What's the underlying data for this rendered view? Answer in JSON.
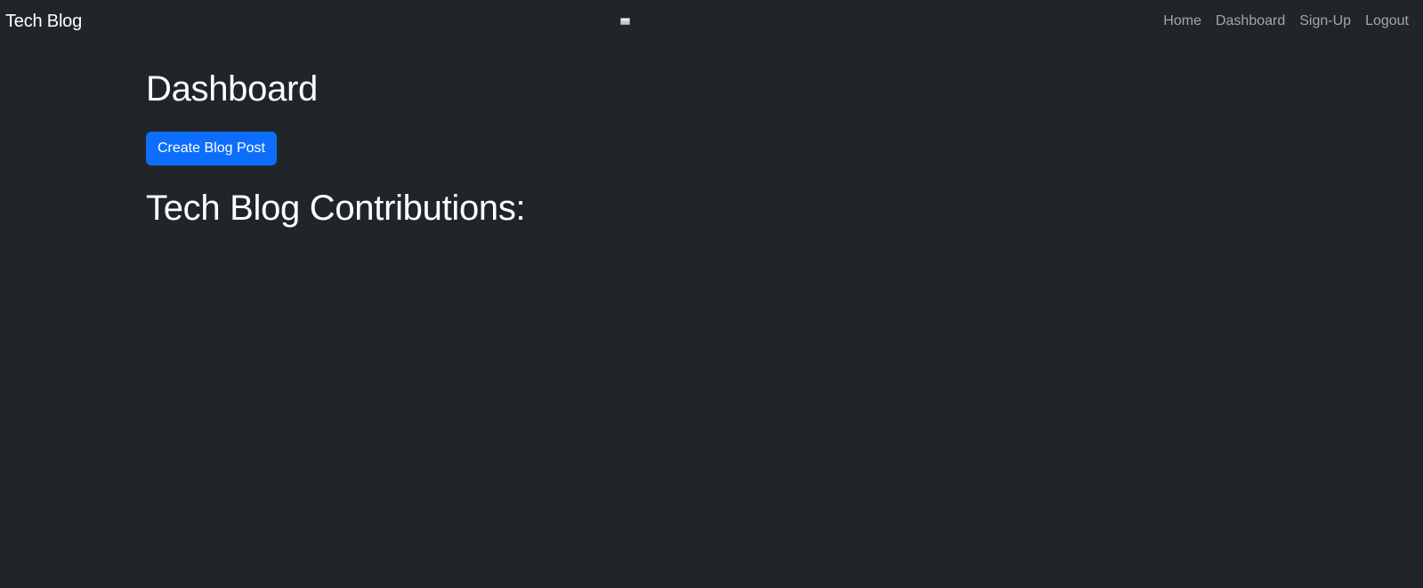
{
  "navbar": {
    "brand": "Tech Blog",
    "links": [
      {
        "label": "Home"
      },
      {
        "label": "Dashboard"
      },
      {
        "label": "Sign-Up"
      },
      {
        "label": "Logout"
      }
    ]
  },
  "main": {
    "title": "Dashboard",
    "create_button_label": "Create Blog Post",
    "section_title": "Tech Blog Contributions:"
  },
  "colors": {
    "background": "#212529",
    "primary_button": "#0d6efd",
    "nav_link": "#a2a7ac",
    "text": "#ffffff"
  }
}
